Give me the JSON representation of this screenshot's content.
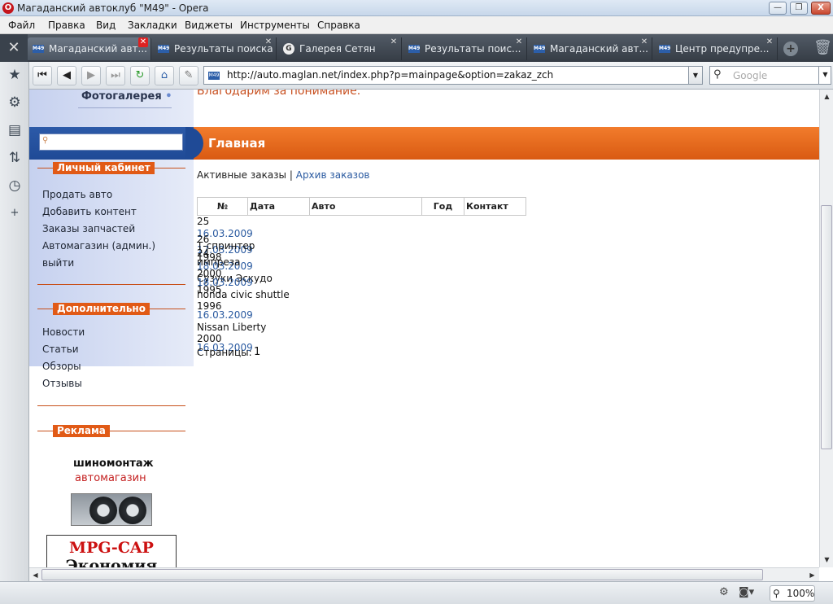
{
  "window": {
    "title": "Магаданский автоклуб \"M49\" - Opera",
    "minimize": "—",
    "maximize": "❐",
    "close": "X"
  },
  "menu": [
    "Файл",
    "Правка",
    "Вид",
    "Закладки",
    "Виджеты",
    "Инструменты",
    "Справка"
  ],
  "tabs": [
    {
      "label": "Магаданский авт...",
      "favicon": "M49",
      "active": true
    },
    {
      "label": "Результаты поиска",
      "favicon": "M49"
    },
    {
      "label": "Галерея Сетян",
      "favicon": "G"
    },
    {
      "label": "Результаты поис...",
      "favicon": "M49"
    },
    {
      "label": "Магаданский авт...",
      "favicon": "M49"
    },
    {
      "label": "Центр предупре...",
      "favicon": "M49"
    }
  ],
  "address": {
    "url": "http://auto.maglan.net/index.php?p=mainpage&option=zakaz_zch",
    "favicon": "M49"
  },
  "search": {
    "placeholder": "Google"
  },
  "page": {
    "gallery_link": "Фотогалерея",
    "thanks_text": "Благодарим за понимание.",
    "main_title": "Главная",
    "orders_tabs": {
      "active": "Активные заказы",
      "separator": "|",
      "archive": "Архив заказов"
    },
    "table_headers": [
      "№",
      "Дата",
      "Авто",
      "Год",
      "Контакт"
    ],
    "overlapping_rows": [
      {
        "text": "25",
        "link": false
      },
      {
        "text": "16.03.2009",
        "link": true
      },
      {
        "text": "26",
        "link": false
      },
      {
        "text": "17.03.2009",
        "link": true
      },
      {
        "text": "Т-спринтер",
        "link": false
      },
      {
        "text": "1998",
        "link": false
      },
      {
        "text": "24",
        "link": false
      },
      {
        "text": "18.03.2009",
        "link": true
      },
      {
        "text": "импреза",
        "link": false
      },
      {
        "text": "2000",
        "link": false
      },
      {
        "text": "Сузуки Эскудо",
        "link": false
      },
      {
        "text": "1995",
        "link": false
      },
      {
        "text": "18.03.2009",
        "link": true
      },
      {
        "text": "honda civic shuttle",
        "link": false
      },
      {
        "text": "1996",
        "link": false
      },
      {
        "text": "16.03.2009",
        "link": true
      },
      {
        "text": "Nissan Liberty",
        "link": false
      },
      {
        "text": "2000",
        "link": false
      },
      {
        "text": "16.03.2009",
        "link": true
      },
      {
        "text": "Страницы:",
        "link": false
      }
    ],
    "pages_label": "Страницы:",
    "pages_value": "1"
  },
  "sidebar": {
    "cabinet_title": "Личный кабинет",
    "cabinet_items": [
      "Продать авто",
      "Добавить контент",
      "Заказы запчастей",
      "Автомагазин (админ.)",
      "выйти"
    ],
    "extra_title": "Дополнительно",
    "extra_items": [
      "Новости",
      "Статьи",
      "Обзоры",
      "Отзывы"
    ],
    "ads_title": "Реклама",
    "ad_line1": "шиномонтаж",
    "ad_line2": "автомагазин",
    "ad2_line1": "MPG-CAP",
    "ad2_line2": "Экономия"
  },
  "status": {
    "zoom": "100%"
  },
  "colors": {
    "accent_orange": "#e15a16",
    "header_blue": "#1f4a96",
    "link_blue": "#2a5aa0"
  }
}
